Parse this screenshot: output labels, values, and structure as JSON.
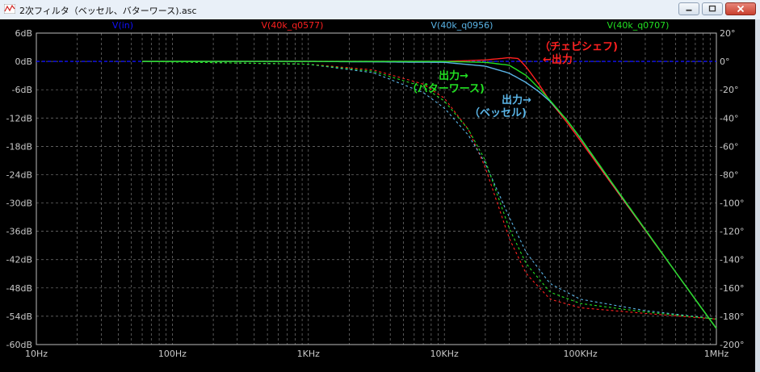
{
  "window": {
    "title": "2次フィルタ（ベッセル、バターワース).asc",
    "buttons": [
      "minimize",
      "maximize",
      "close"
    ],
    "icon": "waveform-icon"
  },
  "colors": {
    "background": "#000000",
    "grid": "#7a7a7a",
    "axis_text": "#c8c8c8",
    "Vin": "#1010ff",
    "q0577": "#ff2020",
    "q0956": "#5ab4e6",
    "q0707": "#22e022"
  },
  "chart_data": {
    "type": "line",
    "title": "",
    "xscale": "log",
    "xlim": [
      10,
      1000000
    ],
    "x_ticks": [
      "10Hz",
      "100Hz",
      "1KHz",
      "10KHz",
      "100KHz",
      "1MHz"
    ],
    "y_left_lim": [
      -60,
      6
    ],
    "y_left_ticks": [
      "6dB",
      "0dB",
      "-6dB",
      "-12dB",
      "-18dB",
      "-24dB",
      "-30dB",
      "-36dB",
      "-42dB",
      "-48dB",
      "-54dB",
      "-60dB"
    ],
    "y_right_lim": [
      -200,
      20
    ],
    "y_right_ticks": [
      "20°",
      "0°",
      "-20°",
      "-40°",
      "-60°",
      "-80°",
      "-100°",
      "-120°",
      "-140°",
      "-160°",
      "-180°",
      "-200°"
    ],
    "legend": [
      "V(in)",
      "V(40k_q0577)",
      "V(40k_q0956)",
      "V(40k_q0707)"
    ],
    "series": [
      {
        "name": "V(in)",
        "style": "dashed",
        "magnitude_db": [
          [
            10,
            0
          ],
          [
            1000000,
            0
          ]
        ]
      },
      {
        "name": "V(40k_q0577)",
        "style": "solid",
        "magnitude_db": [
          [
            60,
            0
          ],
          [
            1000,
            0
          ],
          [
            10000,
            0
          ],
          [
            20000,
            0.3
          ],
          [
            30000,
            0.8
          ],
          [
            35000,
            0.6
          ],
          [
            40000,
            -1.2
          ],
          [
            50000,
            -5
          ],
          [
            60000,
            -8.5
          ],
          [
            80000,
            -13
          ],
          [
            100000,
            -16.8
          ],
          [
            200000,
            -28.8
          ],
          [
            500000,
            -44.6
          ],
          [
            1000000,
            -56.6
          ]
        ],
        "phase_deg": [
          [
            60,
            0
          ],
          [
            1000,
            -2
          ],
          [
            3000,
            -6
          ],
          [
            7000,
            -16
          ],
          [
            10000,
            -26
          ],
          [
            15000,
            -48
          ],
          [
            20000,
            -75
          ],
          [
            30000,
            -125
          ],
          [
            40000,
            -150
          ],
          [
            60000,
            -168
          ],
          [
            100000,
            -174
          ],
          [
            300000,
            -178
          ],
          [
            1000000,
            -182
          ]
        ]
      },
      {
        "name": "V(40k_q0956)",
        "style": "solid",
        "magnitude_db": [
          [
            60,
            0
          ],
          [
            1000,
            0
          ],
          [
            10000,
            -0.2
          ],
          [
            20000,
            -1
          ],
          [
            30000,
            -2.5
          ],
          [
            40000,
            -4.5
          ],
          [
            50000,
            -6.5
          ],
          [
            60000,
            -8.5
          ],
          [
            80000,
            -12.5
          ],
          [
            100000,
            -16.3
          ],
          [
            200000,
            -28.6
          ],
          [
            500000,
            -44.6
          ],
          [
            1000000,
            -56.6
          ]
        ],
        "phase_deg": [
          [
            60,
            0
          ],
          [
            1000,
            -2
          ],
          [
            3000,
            -8
          ],
          [
            7000,
            -22
          ],
          [
            10000,
            -33
          ],
          [
            15000,
            -52
          ],
          [
            20000,
            -72
          ],
          [
            30000,
            -110
          ],
          [
            40000,
            -135
          ],
          [
            60000,
            -157
          ],
          [
            100000,
            -168
          ],
          [
            300000,
            -176
          ],
          [
            1000000,
            -182
          ]
        ]
      },
      {
        "name": "V(40k_q0707)",
        "style": "solid",
        "magnitude_db": [
          [
            60,
            0
          ],
          [
            1000,
            0
          ],
          [
            10000,
            0
          ],
          [
            20000,
            -0.2
          ],
          [
            30000,
            -0.8
          ],
          [
            40000,
            -3
          ],
          [
            50000,
            -5.8
          ],
          [
            60000,
            -8.3
          ],
          [
            80000,
            -12.5
          ],
          [
            100000,
            -16.2
          ],
          [
            200000,
            -28.5
          ],
          [
            500000,
            -44.6
          ],
          [
            1000000,
            -56.6
          ]
        ],
        "phase_deg": [
          [
            60,
            0
          ],
          [
            1000,
            -2
          ],
          [
            3000,
            -7
          ],
          [
            7000,
            -18
          ],
          [
            10000,
            -28
          ],
          [
            15000,
            -48
          ],
          [
            20000,
            -70
          ],
          [
            30000,
            -118
          ],
          [
            40000,
            -143
          ],
          [
            60000,
            -163
          ],
          [
            100000,
            -171
          ],
          [
            300000,
            -177
          ],
          [
            1000000,
            -182
          ]
        ]
      }
    ],
    "annotations": [
      {
        "text": "（チェビシェフ)",
        "color": "#ff2020"
      },
      {
        "text": "←出力",
        "color": "#ff2020"
      },
      {
        "text": "出力→",
        "color": "#22e022"
      },
      {
        "text": "（バターワース)",
        "color": "#22e022"
      },
      {
        "text": "出力→",
        "color": "#5ab4e6"
      },
      {
        "text": "（ベッセル)",
        "color": "#5ab4e6"
      }
    ]
  }
}
